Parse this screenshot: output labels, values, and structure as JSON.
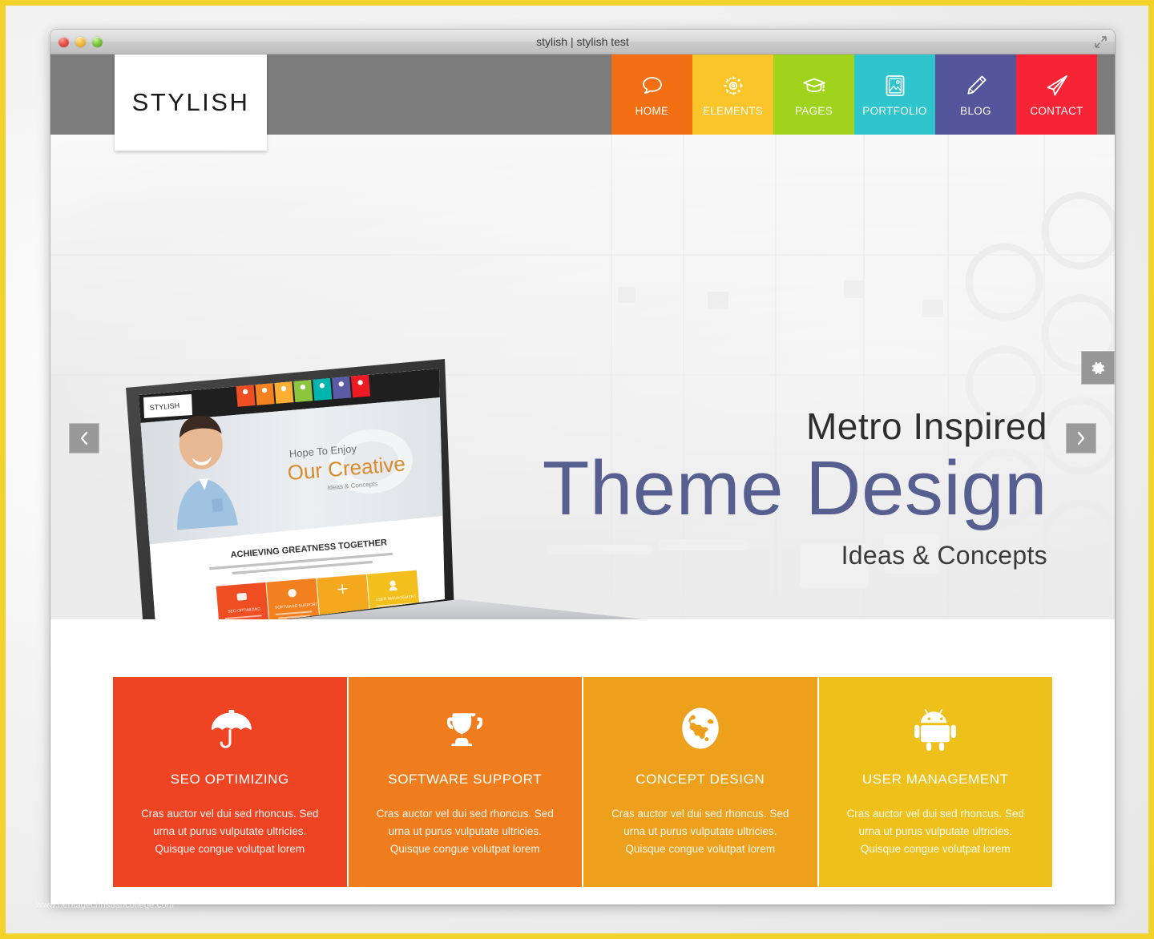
{
  "window": {
    "title": "stylish | stylish test",
    "controls": {
      "close": "close",
      "minimize": "minimize",
      "zoom": "zoom"
    },
    "resize_icon": "resize-icon"
  },
  "watermark": "www.heritagechristiancollege.com",
  "site": {
    "logo": "STYLISH",
    "header_bg": "#7c7c7c",
    "nav": [
      {
        "label": "HOME",
        "icon": "speech-bubble-icon",
        "color": "#f36f13"
      },
      {
        "label": "ELEMENTS",
        "icon": "gear-icon",
        "color": "#fac52a"
      },
      {
        "label": "PAGES",
        "icon": "graduation-cap-icon",
        "color": "#9fd31c"
      },
      {
        "label": "PORTFOLIO",
        "icon": "image-frame-icon",
        "color": "#2ec5cd"
      },
      {
        "label": "BLOG",
        "icon": "pencil-icon",
        "color": "#54559a"
      },
      {
        "label": "CONTACT",
        "icon": "paper-plane-icon",
        "color": "#f62434"
      }
    ]
  },
  "hero": {
    "line1": "Metro Inspired",
    "line2": "Theme Design",
    "line3": "Ideas & Concepts",
    "line2_color": "#565f8f",
    "prev_arrow": "‹",
    "next_arrow": "›",
    "gear_icon": "gear-icon",
    "laptop": {
      "logo": "STYLISH",
      "tagline_small": "Hope To Enjoy",
      "tagline_big": "Our Creative",
      "tagline_sub": "Ideas & Concepts",
      "section_heading": "ACHIEVING GREATNESS TOGETHER",
      "tile_labels": [
        "SEO OPTIMIZING",
        "SOFTWARE SUPPORT",
        "",
        "USER MANAGEMENT"
      ],
      "nav_tile_colors": [
        "#f04e23",
        "#f58220",
        "#fbb034",
        "#8cc63f",
        "#00b5ad",
        "#5b5ba5",
        "#ed1c24"
      ],
      "tile_colors": [
        "#ef4e23",
        "#f2801f",
        "#f4a81d",
        "#f2bf1d"
      ]
    }
  },
  "features": [
    {
      "title": "SEO OPTIMIZING",
      "icon": "umbrella-icon",
      "color": "#ef4423",
      "desc": "Cras auctor vel dui sed rhoncus. Sed urna ut purus vulputate ultricies. Quisque congue volutpat lorem"
    },
    {
      "title": "SOFTWARE SUPPORT",
      "icon": "trophy-icon",
      "color": "#f07d1d",
      "desc": "Cras auctor vel dui sed rhoncus. Sed urna ut purus vulputate ultricies. Quisque congue volutpat lorem"
    },
    {
      "title": "CONCEPT DESIGN",
      "icon": "globe-icon",
      "color": "#eda01b",
      "desc": "Cras auctor vel dui sed rhoncus. Sed urna ut purus vulputate ultricies. Quisque congue volutpat lorem"
    },
    {
      "title": "USER MANAGEMENT",
      "icon": "android-robot-icon",
      "color": "#eec01c",
      "desc": "Cras auctor vel dui sed rhoncus. Sed urna ut purus vulputate ultricies. Quisque congue volutpat lorem"
    }
  ]
}
